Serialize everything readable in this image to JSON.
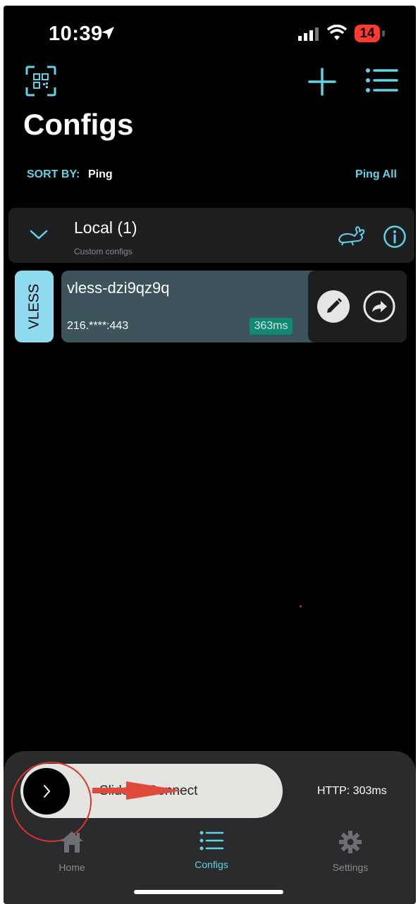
{
  "status": {
    "time": "10:39",
    "battery": "14"
  },
  "header": {
    "title": "Configs"
  },
  "sort": {
    "label": "SORT BY:",
    "value": "Ping",
    "ping_all": "Ping All"
  },
  "group": {
    "title": "Local (1)",
    "subtitle": "Custom configs"
  },
  "config": {
    "type": "VLESS",
    "name": "vless-dzi9qz9q",
    "address": "216.****:443",
    "ping": "363ms"
  },
  "connect": {
    "slider_label": "Slide to Connect",
    "http_status": "HTTP: 303ms"
  },
  "nav": {
    "items": [
      {
        "label": "Home"
      },
      {
        "label": "Configs"
      },
      {
        "label": "Settings"
      }
    ]
  },
  "colors": {
    "accent": "#5fd3e8",
    "ping_badge": "#0f8a73",
    "annotation": "#d9342b"
  },
  "icons": [
    "location-arrow-icon",
    "signal-icon",
    "wifi-icon",
    "qr-scan-icon",
    "plus-icon",
    "list-icon",
    "chevron-down-icon",
    "rabbit-icon",
    "info-icon",
    "pencil-icon",
    "share-arrow-icon",
    "chevron-right-icon",
    "home-icon",
    "list-icon",
    "gear-icon"
  ]
}
